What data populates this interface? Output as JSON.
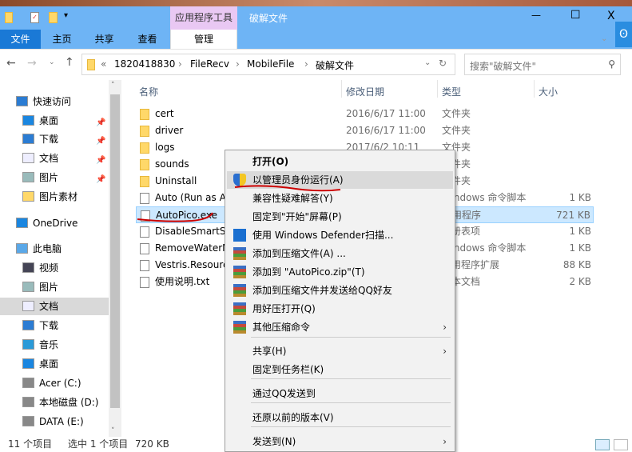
{
  "window": {
    "title": "破解文件",
    "context_tab_header": "应用程序工具",
    "minimize": "—",
    "maximize": "☐",
    "close": "X"
  },
  "ribbon": {
    "tabs": [
      "文件",
      "主页",
      "共享",
      "查看"
    ],
    "context_tab": "管理"
  },
  "address": {
    "overflow": "«",
    "crumbs": [
      "1820418830",
      "FileRecv",
      "MobileFile",
      "破解文件"
    ],
    "search_placeholder": "搜索\"破解文件\""
  },
  "nav": {
    "items": [
      {
        "label": "快速访问",
        "icon": "star-icon"
      },
      {
        "label": "桌面",
        "icon": "desktop-icon",
        "pinned": true
      },
      {
        "label": "下载",
        "icon": "download-icon",
        "pinned": true
      },
      {
        "label": "文档",
        "icon": "document-icon",
        "pinned": true
      },
      {
        "label": "图片",
        "icon": "picture-icon",
        "pinned": true
      },
      {
        "label": "图片素材",
        "icon": "folder-icon"
      },
      {
        "label": "OneDrive",
        "icon": "cloud-icon"
      },
      {
        "label": "此电脑",
        "icon": "computer-icon"
      },
      {
        "label": "视频",
        "icon": "video-icon"
      },
      {
        "label": "图片",
        "icon": "picture-icon"
      },
      {
        "label": "文档",
        "icon": "document-icon"
      },
      {
        "label": "下载",
        "icon": "download-icon"
      },
      {
        "label": "音乐",
        "icon": "music-icon"
      },
      {
        "label": "桌面",
        "icon": "desktop-icon"
      },
      {
        "label": "Acer (C:)",
        "icon": "drive-icon"
      },
      {
        "label": "本地磁盘 (D:)",
        "icon": "drive-icon"
      },
      {
        "label": "DATA (E:)",
        "icon": "drive-icon"
      }
    ]
  },
  "columns": {
    "name": "名称",
    "date": "修改日期",
    "type": "类型",
    "size": "大小"
  },
  "files": [
    {
      "name": "cert",
      "date": "2016/6/17 11:00",
      "type": "文件夹",
      "size": ""
    },
    {
      "name": "driver",
      "date": "2016/6/17 11:00",
      "type": "文件夹",
      "size": ""
    },
    {
      "name": "logs",
      "date": "2017/6/2 10:11",
      "type": "文件夹",
      "size": ""
    },
    {
      "name": "sounds",
      "date": "",
      "type": "文件夹",
      "size": ""
    },
    {
      "name": "Uninstall",
      "date": "",
      "type": "文件夹",
      "size": ""
    },
    {
      "name": "Auto (Run as A",
      "date": "",
      "type": "Windows 命令脚本",
      "size": "1 KB"
    },
    {
      "name": "AutoPico.exe",
      "date": "",
      "type": "应用程序",
      "size": "721 KB"
    },
    {
      "name": "DisableSmartSc",
      "date": "",
      "type": "注册表项",
      "size": "1 KB"
    },
    {
      "name": "RemoveWaterM",
      "date": "",
      "type": "Windows 命令脚本",
      "size": "1 KB"
    },
    {
      "name": "Vestris.Resourc",
      "date": "",
      "type": "应用程序扩展",
      "size": "88 KB"
    },
    {
      "name": "使用说明.txt",
      "date": "",
      "type": "文本文档",
      "size": "2 KB"
    }
  ],
  "context_menu": [
    "打开(O)",
    "以管理员身份运行(A)",
    "兼容性疑难解答(Y)",
    "固定到\"开始\"屏幕(P)",
    "使用 Windows Defender扫描...",
    "添加到压缩文件(A) ...",
    "添加到 \"AutoPico.zip\"(T)",
    "添加到压缩文件并发送给QQ好友",
    "用好压打开(Q)",
    "其他压缩命令",
    "共享(H)",
    "固定到任务栏(K)",
    "通过QQ发送到",
    "还原以前的版本(V)",
    "发送到(N)"
  ],
  "status": {
    "count": "11 个项目",
    "selected": "选中 1 个项目",
    "size": "720 KB"
  }
}
